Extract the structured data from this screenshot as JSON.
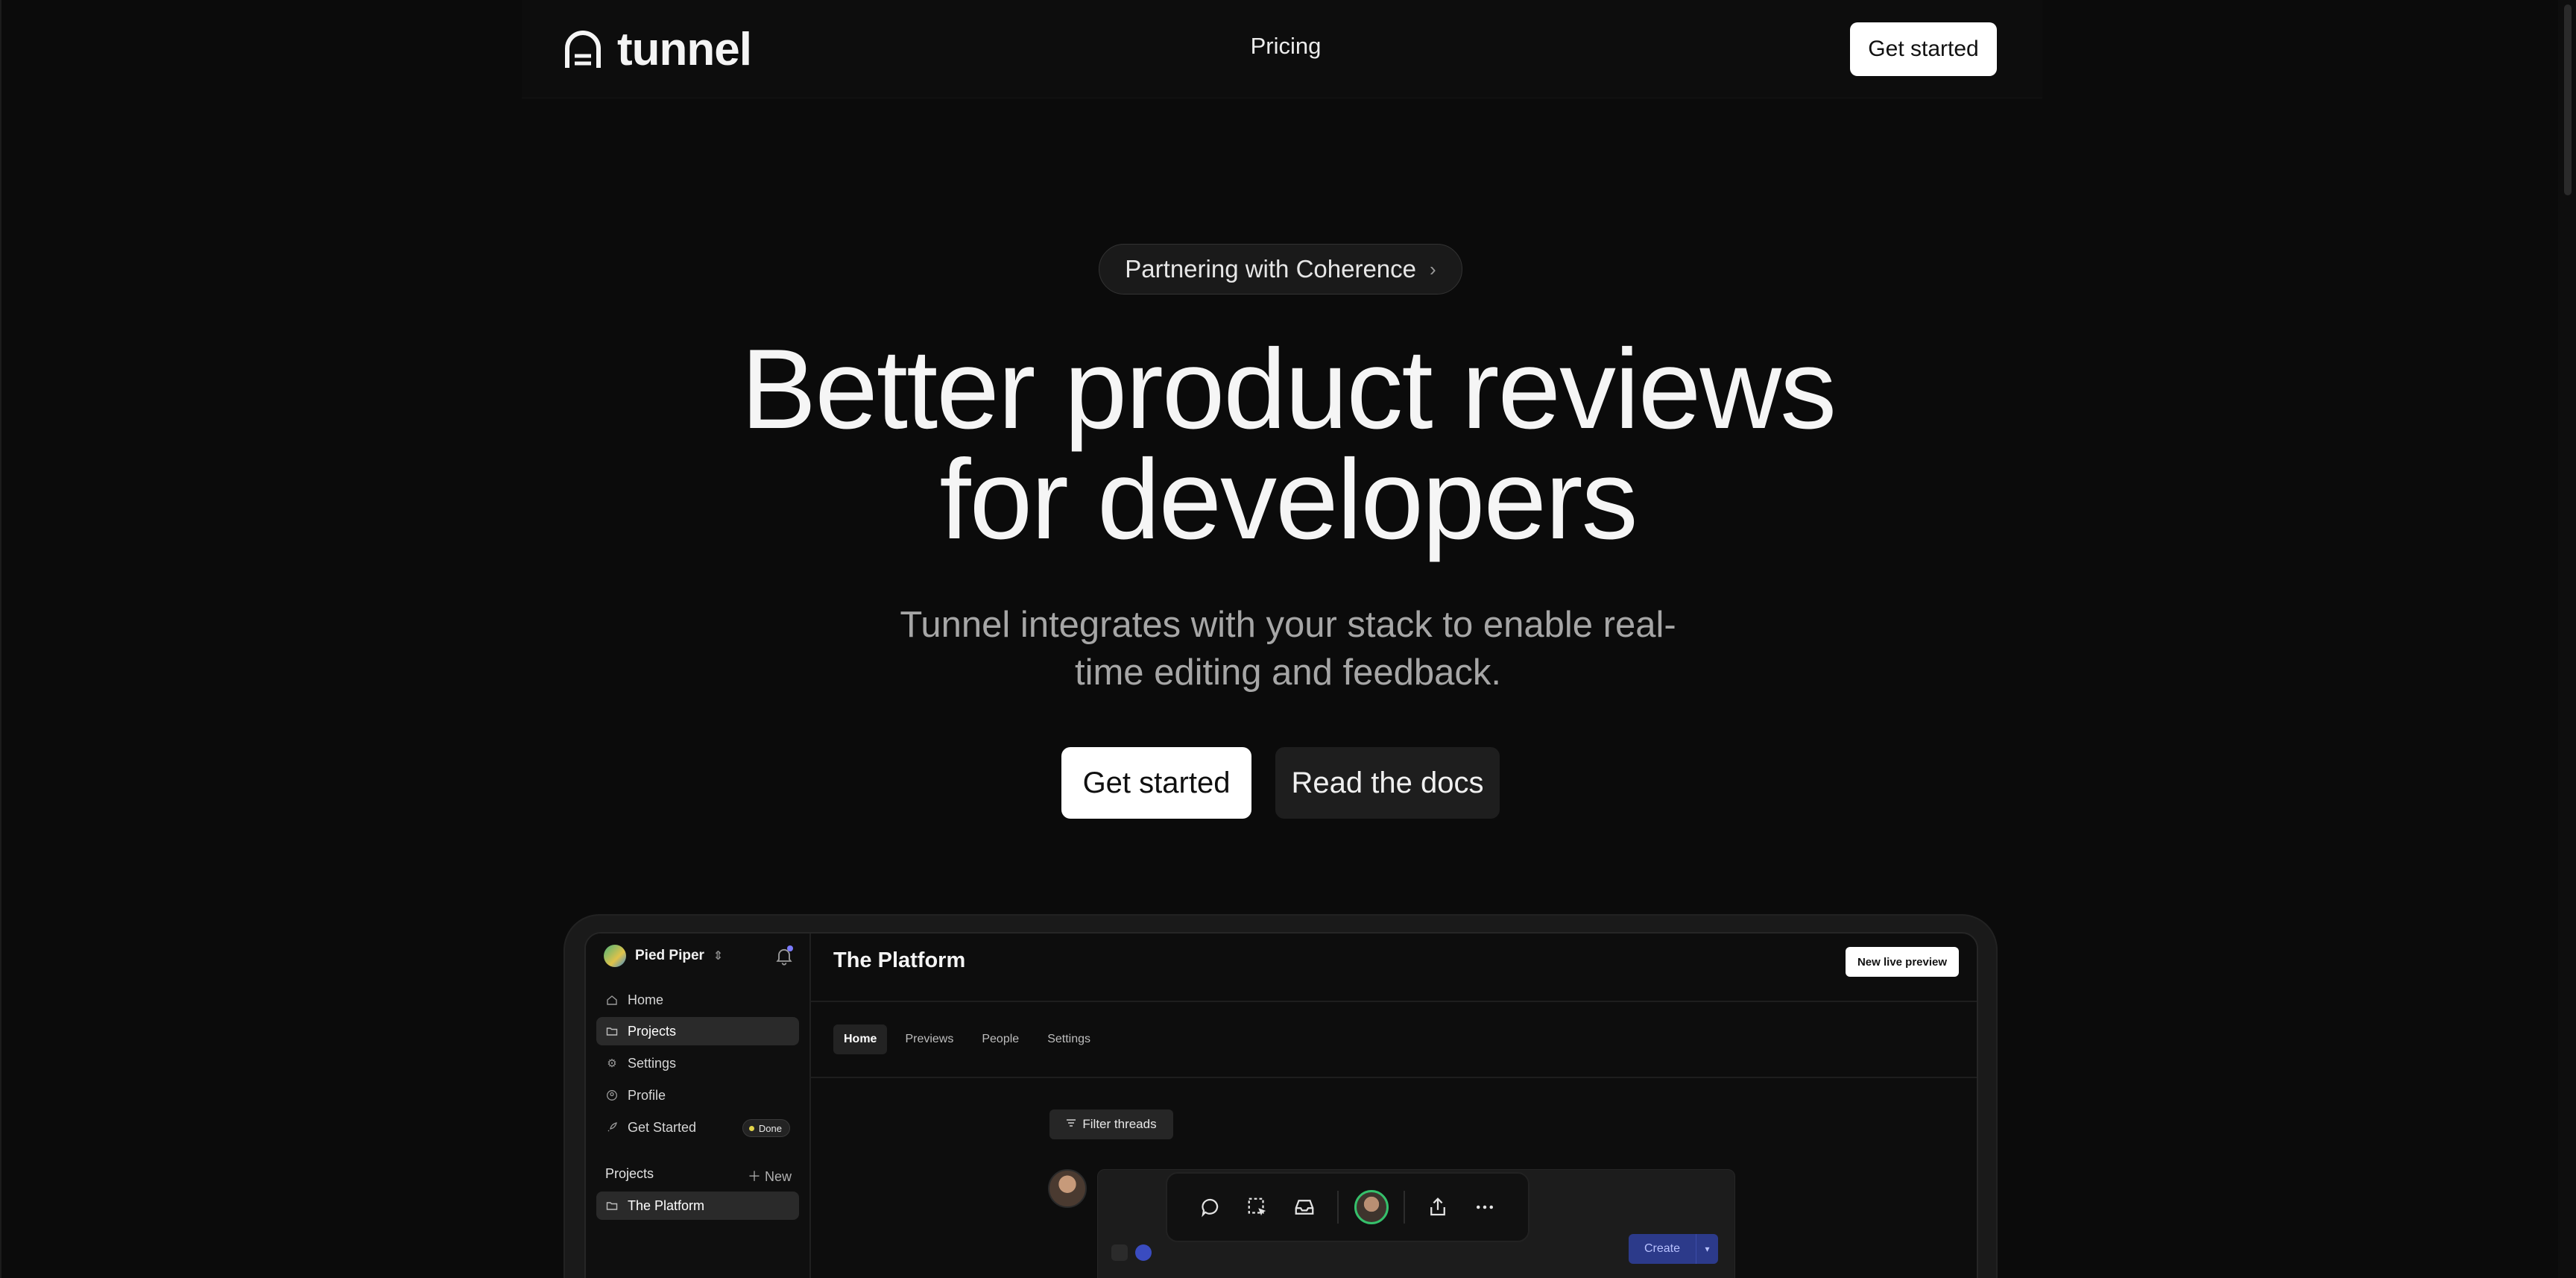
{
  "nav": {
    "logo_text": "tunnel",
    "links": [
      "Pricing"
    ],
    "cta_label": "Get started"
  },
  "announcement": {
    "label": "Partnering with Coherence",
    "icon": "chevron-right-icon"
  },
  "hero": {
    "title_line1": "Better product reviews",
    "title_line2": "for developers",
    "subtitle_line1": "Tunnel integrates with your stack to enable real-",
    "subtitle_line2": "time editing and feedback.",
    "primary_label": "Get started",
    "secondary_label": "Read the docs"
  },
  "app_preview": {
    "workspace": {
      "name": "Pied Piper",
      "switch_icon": "chevron-updown-icon",
      "notification_icon": "bell-icon"
    },
    "sidebar": {
      "items": [
        {
          "label": "Home",
          "icon": "home-icon",
          "active": false
        },
        {
          "label": "Projects",
          "icon": "folder-icon",
          "active": true
        },
        {
          "label": "Settings",
          "icon": "gear-icon",
          "active": false
        },
        {
          "label": "Profile",
          "icon": "user-circle-icon",
          "active": false
        },
        {
          "label": "Get Started",
          "icon": "rocket-icon",
          "active": false,
          "badge": "Done"
        }
      ],
      "projects_header": "Projects",
      "new_label": "New",
      "projects": [
        {
          "label": "The Platform",
          "icon": "folder-icon",
          "active": true
        }
      ]
    },
    "main": {
      "title": "The Platform",
      "new_preview_label": "New live preview",
      "tabs": [
        {
          "label": "Home",
          "active": true
        },
        {
          "label": "Previews",
          "active": false
        },
        {
          "label": "People",
          "active": false
        },
        {
          "label": "Settings",
          "active": false
        }
      ],
      "filter_label": "Filter threads",
      "create_label": "Create"
    },
    "toolbar": {
      "icons": [
        "comment-icon",
        "select-area-icon",
        "inbox-icon",
        "avatar",
        "share-icon",
        "more-icon"
      ]
    }
  },
  "colors": {
    "background": "#0b0b0b",
    "surface": "#1a1a1a",
    "primary_button": "#ffffff",
    "accent_blue": "#2c3a8a",
    "presence_green": "#35c06b",
    "status_yellow": "#e2d44a"
  }
}
